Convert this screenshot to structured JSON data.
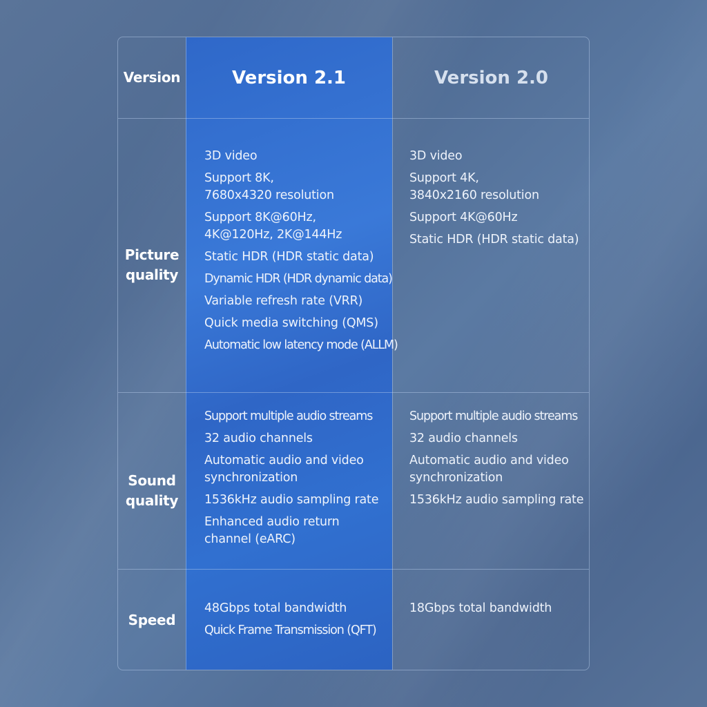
{
  "table": {
    "corner_label": "Version",
    "columns": [
      "Version 2.1",
      "Version 2.0"
    ],
    "rows": [
      {
        "label": [
          "Picture",
          "quality"
        ],
        "v21": [
          "3D video",
          "Support 8K,\n7680x4320 resolution",
          "Support 8K@60Hz,\n4K@120Hz, 2K@144Hz",
          "Static HDR (HDR static data)",
          "Dynamic HDR (HDR dynamic data)",
          "Variable refresh rate (VRR)",
          "Quick media switching (QMS)",
          "Automatic low latency mode (ALLM)"
        ],
        "v20": [
          "3D video",
          "Support 4K,\n3840x2160 resolution",
          "Support 4K@60Hz",
          "Static HDR (HDR static data)"
        ]
      },
      {
        "label": [
          "Sound",
          "quality"
        ],
        "v21": [
          "Support multiple audio streams",
          "32 audio channels",
          "Automatic audio and video\nsynchronization",
          "1536kHz audio sampling rate",
          "Enhanced audio return\nchannel (eARC)"
        ],
        "v20": [
          "Support multiple audio streams",
          "32 audio channels",
          "Automatic audio and video\nsynchronization",
          "1536kHz audio sampling rate"
        ]
      },
      {
        "label": [
          "Speed"
        ],
        "v21": [
          "48Gbps total bandwidth",
          "Quick Frame Transmission (QFT)"
        ],
        "v20": [
          "18Gbps total bandwidth"
        ]
      }
    ]
  },
  "colors": {
    "highlight_column": "#3170d0",
    "background": "#546f97",
    "header_v20_text": "#d6e0ee"
  }
}
